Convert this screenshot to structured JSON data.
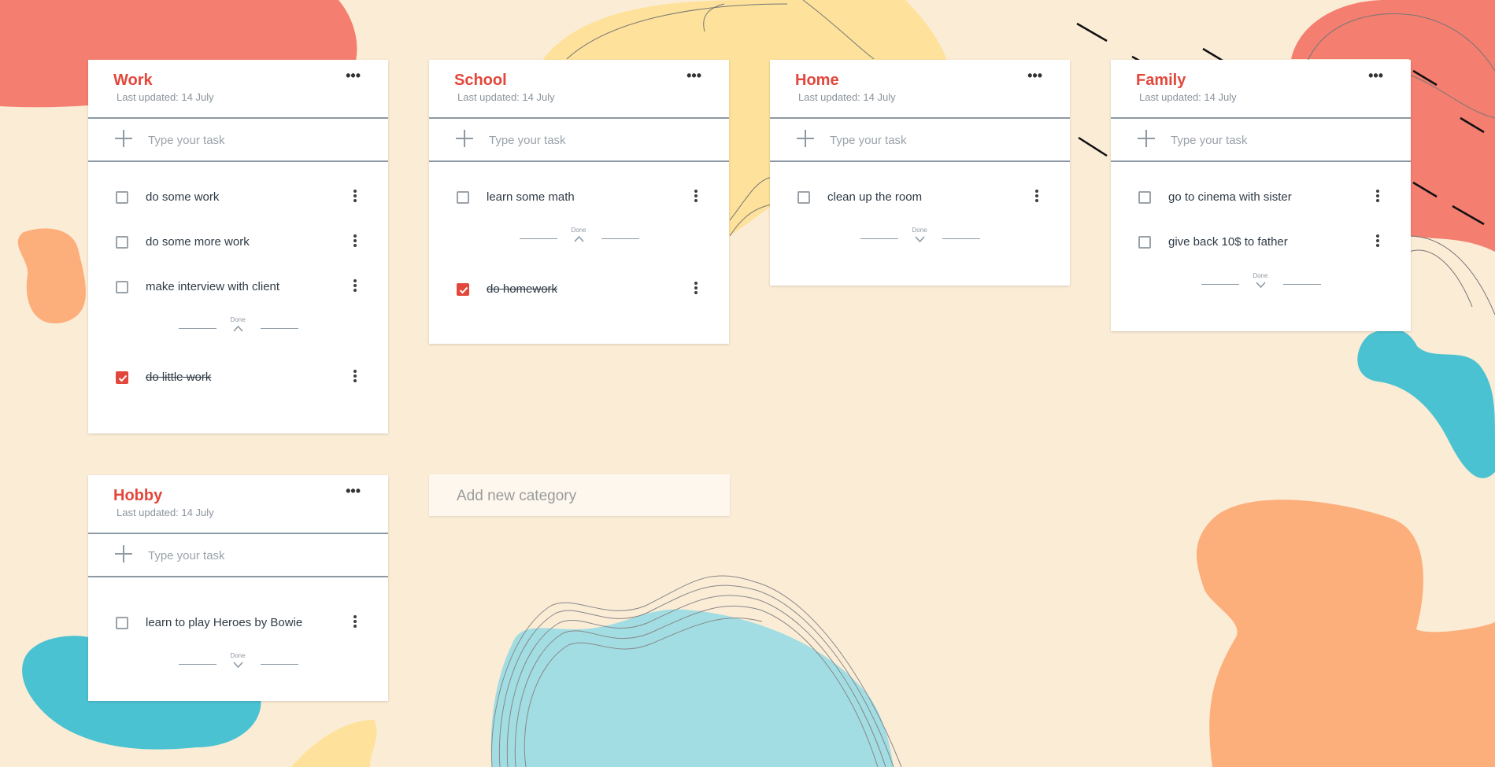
{
  "app": {
    "add_task_placeholder": "Type your task",
    "done_label": "Done",
    "new_category_placeholder": "Add new category",
    "accent_color": "#e2473b"
  },
  "categories": [
    {
      "title": "Work",
      "updated": "Last updated: 14 July",
      "menu": "•••",
      "tasks": [
        "do some work",
        "do some more work",
        "make interview with client"
      ],
      "done_tasks": [
        "do little work"
      ],
      "done_expanded": true
    },
    {
      "title": "School",
      "updated": "Last updated: 14 July",
      "menu": "•••",
      "tasks": [
        "learn some math"
      ],
      "done_tasks": [
        "do homework"
      ],
      "done_expanded": true
    },
    {
      "title": "Home",
      "updated": "Last updated: 14 July",
      "menu": "•••",
      "tasks": [
        "clean up the room"
      ],
      "done_tasks": [],
      "done_expanded": false
    },
    {
      "title": "Family",
      "updated": "Last updated: 14 July",
      "menu": "•••",
      "tasks": [
        "go to cinema with sister",
        "give back 10$ to father"
      ],
      "done_tasks": [],
      "done_expanded": false
    },
    {
      "title": "Hobby",
      "updated": "Last updated: 14 July",
      "menu": "•••",
      "tasks": [
        "learn to play Heroes by Bowie"
      ],
      "done_tasks": [],
      "done_expanded": false
    }
  ]
}
